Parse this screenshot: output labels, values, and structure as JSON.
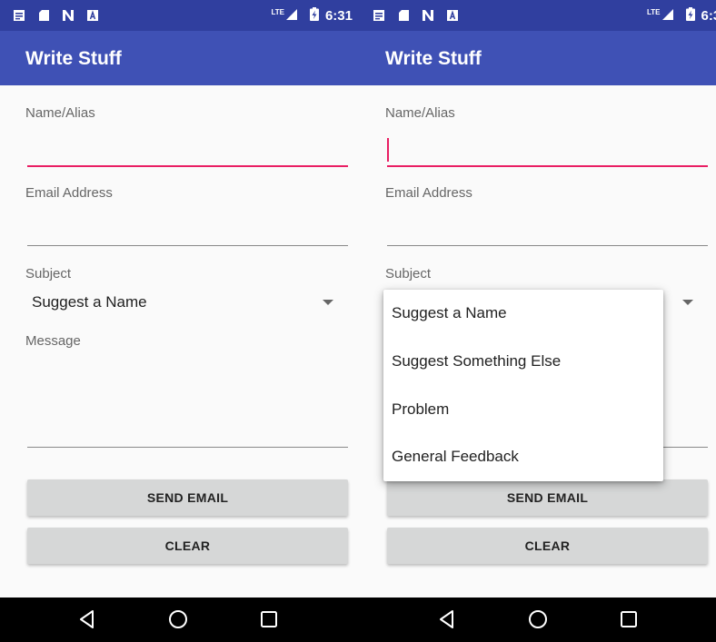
{
  "status_bar": {
    "time": "6:31",
    "network_label": "LTE",
    "icons": [
      "notes-icon",
      "sd-card-icon",
      "n-icon",
      "a-icon"
    ]
  },
  "app": {
    "title": "Write Stuff"
  },
  "form": {
    "name_label": "Name/Alias",
    "email_label": "Email Address",
    "subject_label": "Subject",
    "subject_value": "Suggest a Name",
    "message_label": "Message",
    "send_label": "SEND EMAIL",
    "clear_label": "CLEAR"
  },
  "dropdown": {
    "options": [
      "Suggest a Name",
      "Suggest Something Else",
      "Problem",
      "General Feedback"
    ]
  },
  "colors": {
    "primary": "#3f51b5",
    "primary_dark": "#303f9f",
    "accent": "#e91e63",
    "button": "#d6d7d7"
  }
}
